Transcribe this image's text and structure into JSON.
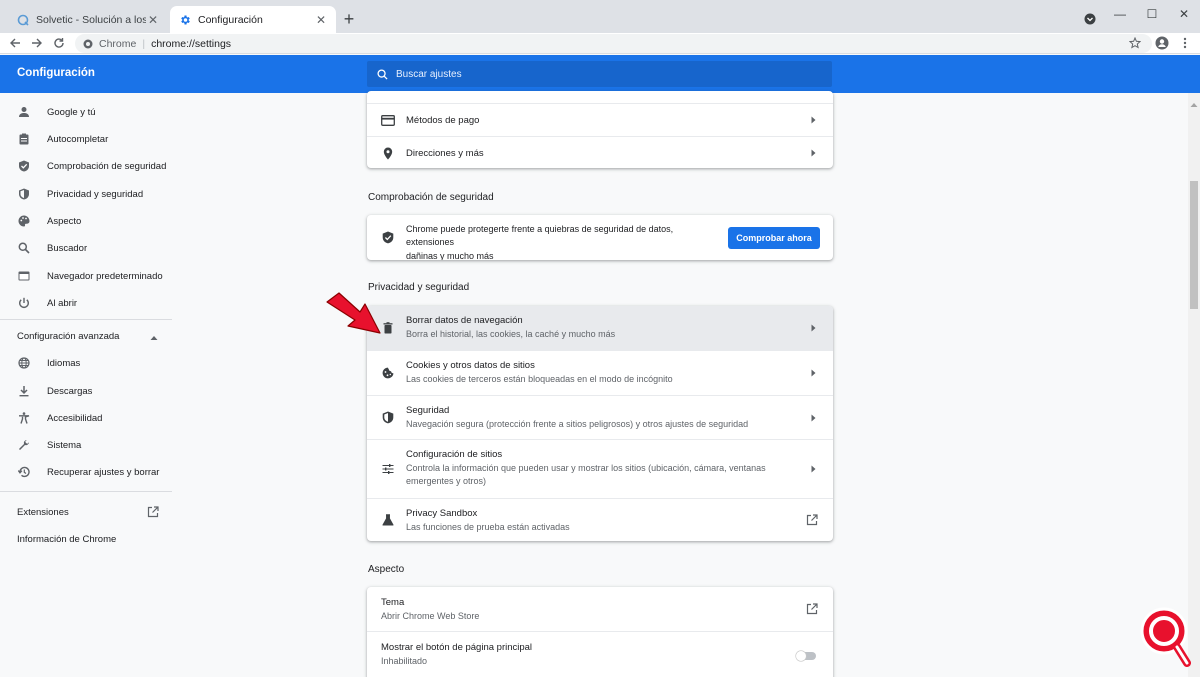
{
  "browser": {
    "tabs": [
      {
        "title": "Solvetic - Solución a los problem",
        "icon": "solvetic-favicon",
        "active": false
      },
      {
        "title": "Configuración",
        "icon": "gear-icon",
        "active": true
      }
    ],
    "omnibox": {
      "origin": "Chrome",
      "url": "chrome://settings"
    }
  },
  "header": {
    "title": "Configuración",
    "search_placeholder": "Buscar ajustes"
  },
  "sidebar": {
    "items": [
      {
        "label": "Google y tú",
        "icon": "person-icon"
      },
      {
        "label": "Autocompletar",
        "icon": "clipboard-icon"
      },
      {
        "label": "Comprobación de seguridad",
        "icon": "shield-check-icon"
      },
      {
        "label": "Privacidad y seguridad",
        "icon": "shield-icon"
      },
      {
        "label": "Aspecto",
        "icon": "palette-icon"
      },
      {
        "label": "Buscador",
        "icon": "search-icon"
      },
      {
        "label": "Navegador predeterminado",
        "icon": "browser-icon"
      },
      {
        "label": "Al abrir",
        "icon": "power-icon"
      }
    ],
    "advanced_label": "Configuración avanzada",
    "advanced_items": [
      {
        "label": "Idiomas",
        "icon": "globe-icon"
      },
      {
        "label": "Descargas",
        "icon": "download-icon"
      },
      {
        "label": "Accesibilidad",
        "icon": "accessibility-icon"
      },
      {
        "label": "Sistema",
        "icon": "wrench-icon"
      },
      {
        "label": "Recuperar ajustes y borrar",
        "icon": "restore-icon"
      }
    ],
    "extensions_label": "Extensiones",
    "about_label": "Información de Chrome"
  },
  "autofill_card": {
    "rows": [
      {
        "label": "Métodos de pago",
        "icon": "credit-card-icon"
      },
      {
        "label": "Direcciones y más",
        "icon": "location-pin-icon"
      }
    ]
  },
  "safety_check": {
    "section_title": "Comprobación de seguridad",
    "text_line1": "Chrome puede protegerte frente a quiebras de seguridad de datos, extensiones",
    "text_line2": "dañinas y mucho más",
    "button_label": "Comprobar ahora"
  },
  "privacy": {
    "section_title": "Privacidad y seguridad",
    "rows": [
      {
        "title": "Borrar datos de navegación",
        "subtitle": "Borra el historial, las cookies, la caché y mucho más",
        "icon": "trash-icon"
      },
      {
        "title": "Cookies y otros datos de sitios",
        "subtitle": "Las cookies de terceros están bloqueadas en el modo de incógnito",
        "icon": "cookie-icon"
      },
      {
        "title": "Seguridad",
        "subtitle": "Navegación segura (protección frente a sitios peligrosos) y otros ajustes de seguridad",
        "icon": "shield-icon"
      },
      {
        "title": "Configuración de sitios",
        "subtitle_line1": "Controla la información que pueden usar y mostrar los sitios (ubicación, cámara, ventanas",
        "subtitle_line2": "emergentes y otros)",
        "icon": "sliders-icon"
      },
      {
        "title": "Privacy Sandbox",
        "subtitle": "Las funciones de prueba están activadas",
        "icon": "flask-icon"
      }
    ]
  },
  "appearance": {
    "section_title": "Aspecto",
    "rows": [
      {
        "title": "Tema",
        "subtitle": "Abrir Chrome Web Store"
      },
      {
        "title": "Mostrar el botón de página principal",
        "subtitle": "Inhabilitado",
        "toggle_on": false
      }
    ]
  },
  "colors": {
    "accent": "#1a73e8",
    "highlight": "#e8eaed",
    "annotation_arrow": "#e8112d"
  }
}
